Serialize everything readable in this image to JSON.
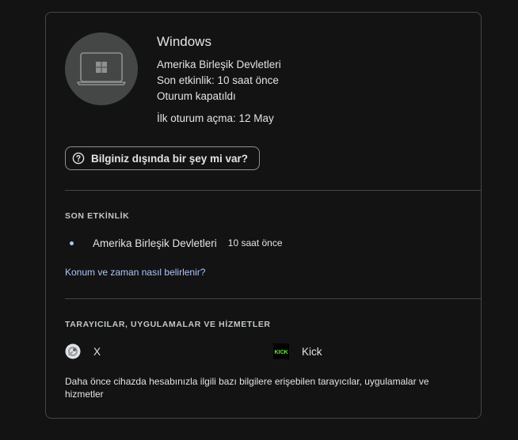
{
  "device": {
    "name": "Windows",
    "location": "Amerika Birleşik Devletleri",
    "last_activity": "Son etkinlik: 10 saat önce",
    "status": "Oturum kapatıldı",
    "first_signin": "İlk oturum açma: 12 May",
    "icon": "windows-laptop-icon"
  },
  "help_button": {
    "label": "Bilginiz dışında bir şey mi var?",
    "icon": "help-circle-icon"
  },
  "recent_activity": {
    "heading": "SON ETKİNLİK",
    "items": [
      {
        "location": "Amerika Birleşik Devletleri",
        "time": "10 saat önce"
      }
    ],
    "link": "Konum ve zaman nasıl belirlenir?"
  },
  "services": {
    "heading": "TARAYICILAR, UYGULAMALAR VE HİZMETLER",
    "items": [
      {
        "label": "X",
        "icon": "x-app-icon"
      },
      {
        "label": "Kick",
        "icon": "kick-app-icon"
      }
    ],
    "footnote": "Daha önce cihazda hesabınızla ilgili bazı bilgilere erişebilen tarayıcılar, uygulamalar ve hizmetler"
  },
  "colors": {
    "background": "#131314",
    "card_border": "#444746",
    "text": "#e3e3e3",
    "link": "#a8c7fa",
    "kick_green": "#53fc18"
  }
}
